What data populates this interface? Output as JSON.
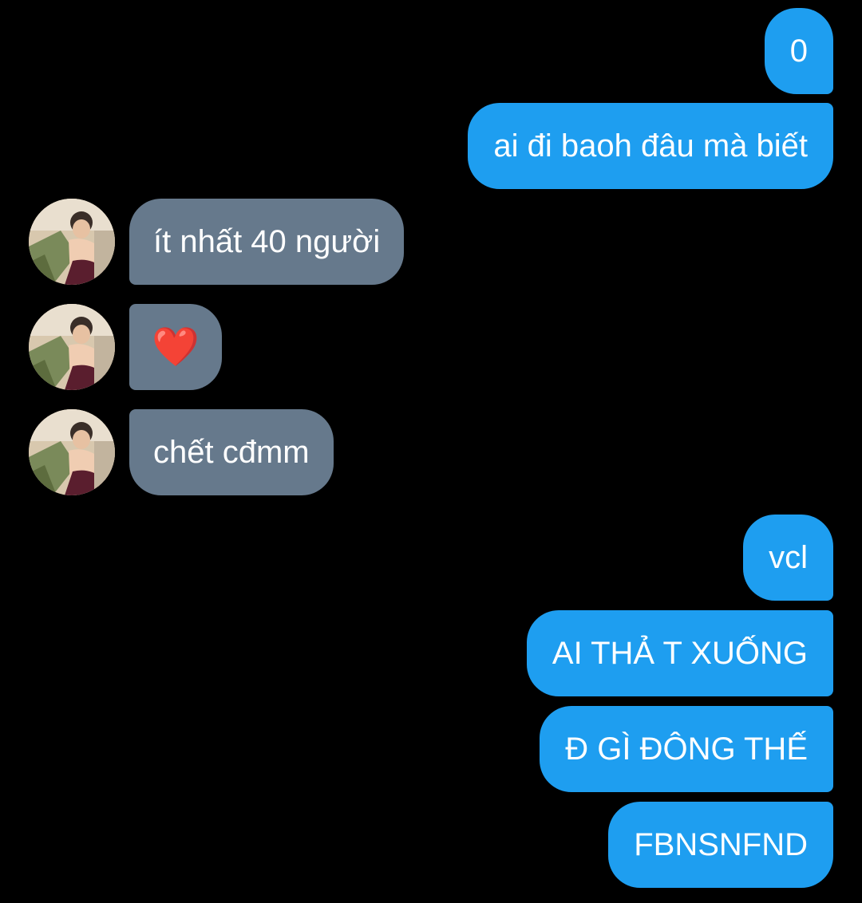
{
  "messages": [
    {
      "side": "out",
      "text": "0"
    },
    {
      "side": "out",
      "text": "ai đi baoh đâu mà biết"
    },
    {
      "side": "in",
      "text": "ít nhất 40 người"
    },
    {
      "side": "in",
      "text": "❤️",
      "icon": "heart-icon"
    },
    {
      "side": "in",
      "text": "chết cđmm"
    },
    {
      "side": "out",
      "text": "vcl"
    },
    {
      "side": "out",
      "text": "AI THẢ T XUỐNG"
    },
    {
      "side": "out",
      "text": "Đ GÌ ĐÔNG THẾ"
    },
    {
      "side": "out",
      "text": "FBNSNFND"
    }
  ],
  "colors": {
    "background": "#000000",
    "outgoing_bubble": "#1e9ef0",
    "incoming_bubble": "#66798c",
    "heart": "#e8263a"
  }
}
